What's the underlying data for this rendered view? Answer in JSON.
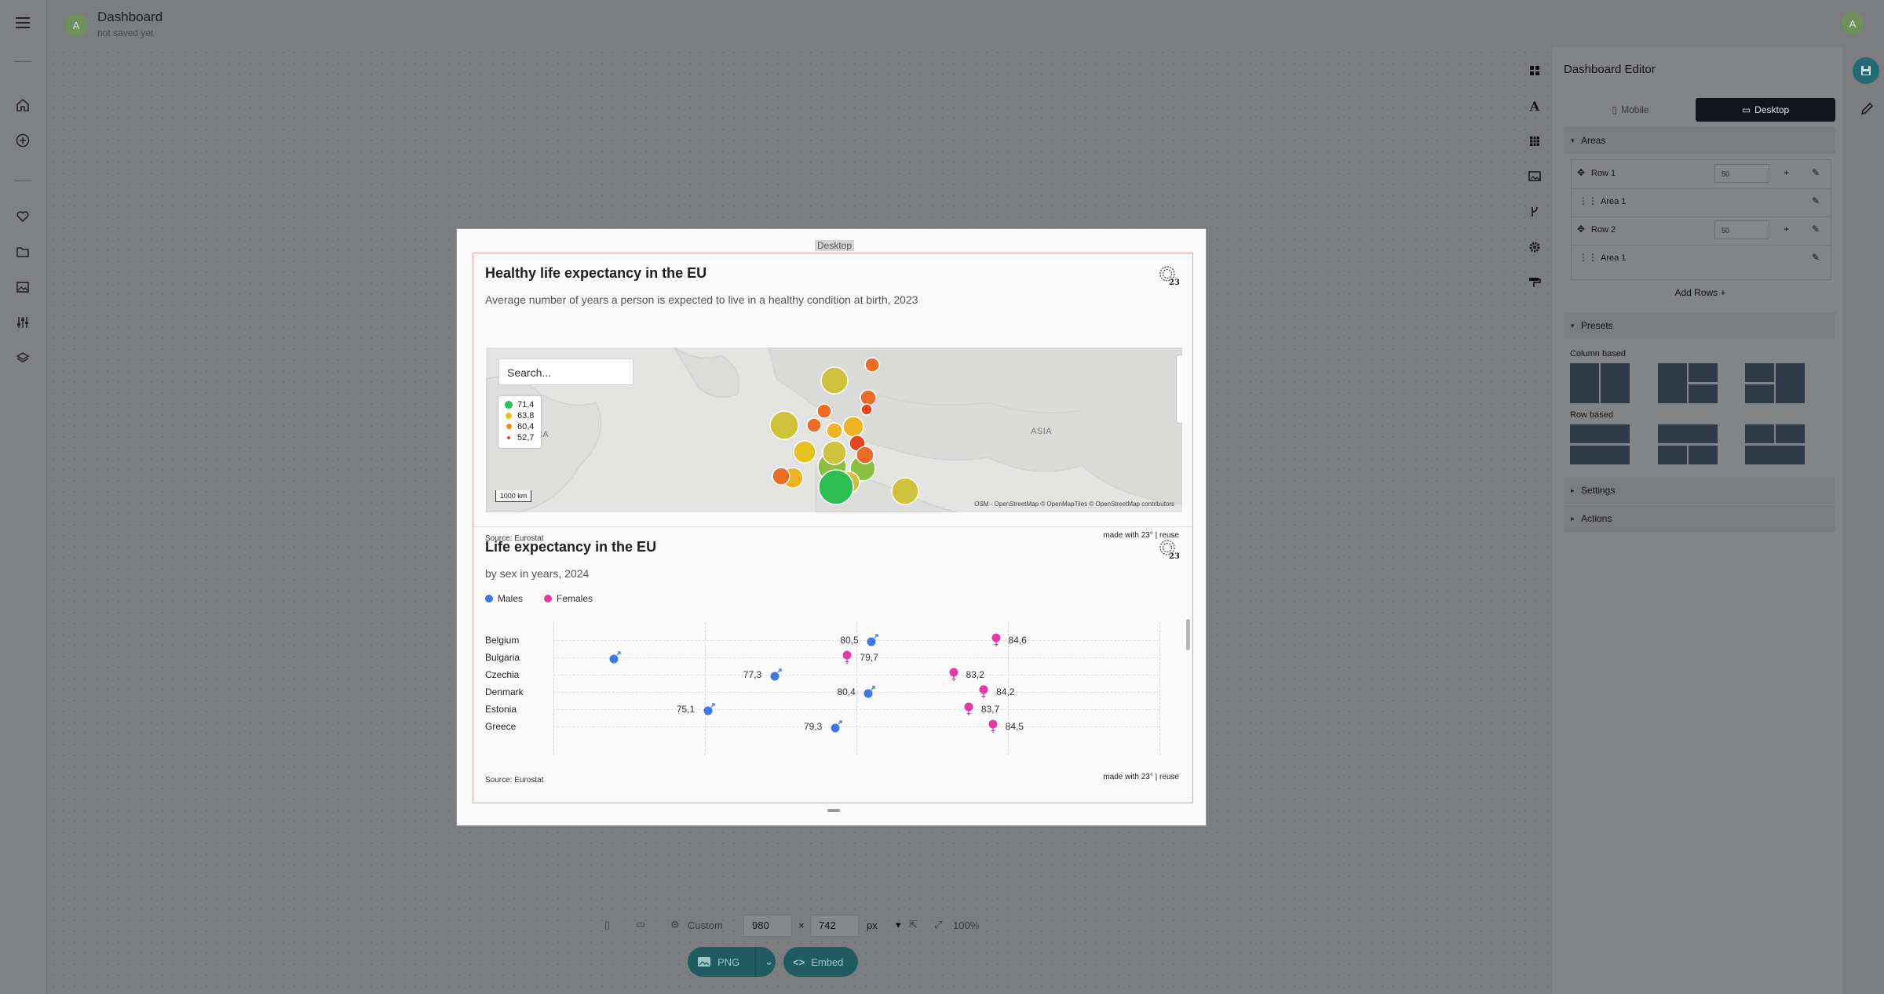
{
  "app": {
    "title": "Dashboard",
    "subtitle": "not saved yet",
    "avatar_initial": "A",
    "user_avatar_initial": "A"
  },
  "rail": {
    "icons": [
      "menu-icon",
      "home-icon",
      "add-circle-icon",
      "heart-icon",
      "folder-icon",
      "image-icon",
      "sliders-icon",
      "layers-icon"
    ]
  },
  "canvas": {
    "mode_label": "Desktop"
  },
  "widget_map": {
    "title": "Healthy life expectancy in the EU",
    "subtitle": "Average number of years a person is expected to live in a healthy condition at birth, 2023",
    "search_placeholder": "Search...",
    "legend": [
      {
        "label": "71,4",
        "color": "#2dbf52"
      },
      {
        "label": "63,8",
        "color": "#e8c21c"
      },
      {
        "label": "60,4",
        "color": "#f28c1a"
      },
      {
        "label": "52,7",
        "color": "#e8441c"
      }
    ],
    "map_labels": {
      "america": "ERICA",
      "asia": "ASIA"
    },
    "scale_label": "1000 km",
    "attribution": "OSM - OpenStreetMap  © OpenMapTiles © OpenStreetMap contributors",
    "source": "Source: Eurostat",
    "made_with": "made with 23° | reuse",
    "logo": "23°"
  },
  "widget_life": {
    "title": "Life expectancy in the EU",
    "subtitle": "by sex in years, 2024",
    "legend": [
      {
        "label": "Males",
        "color": "#3b7ae8"
      },
      {
        "label": "Females",
        "color": "#e23aa6"
      }
    ],
    "source": "Source: Eurostat",
    "made_with": "made with 23° | reuse",
    "logo": "23°"
  },
  "chart_data": {
    "type": "scatter",
    "title": "Life expectancy in the EU",
    "subtitle": "by sex in years, 2024",
    "categories": [
      "Belgium",
      "Bulgaria",
      "Czechia",
      "Denmark",
      "Estonia",
      "Greece"
    ],
    "series": [
      {
        "name": "Males",
        "color": "#3b7ae8",
        "values": [
          80.5,
          72.0,
          77.3,
          80.4,
          75.1,
          79.3
        ],
        "labels": [
          "80,5",
          "",
          "77,3",
          "80,4",
          "75,1",
          "79,3"
        ]
      },
      {
        "name": "Females",
        "color": "#e23aa6",
        "values": [
          84.6,
          79.7,
          83.2,
          84.2,
          83.7,
          84.5
        ],
        "labels": [
          "84,6",
          "79,7",
          "83,2",
          "84,2",
          "83,7",
          "84,5"
        ]
      }
    ],
    "xlim": [
      70,
      90
    ],
    "grid": true,
    "legend_position": "top-left"
  },
  "editor": {
    "title": "Dashboard Editor",
    "modes": {
      "mobile": "Mobile",
      "desktop": "Desktop"
    },
    "sections": {
      "areas": "Areas",
      "presets": "Presets",
      "settings": "Settings",
      "actions": "Actions"
    },
    "rows": [
      {
        "label": "Row 1",
        "height": "50",
        "area": "Area 1"
      },
      {
        "label": "Row 2",
        "height": "50",
        "area": "Area 1"
      }
    ],
    "add_rows": "Add Rows  +",
    "preset_groups": {
      "column": "Column based",
      "row": "Row based"
    }
  },
  "bottom": {
    "size_mode": "Custom",
    "width": "980",
    "height": "742",
    "unit": "px",
    "zoom": "100%",
    "export_format": "PNG",
    "embed": "Embed"
  }
}
